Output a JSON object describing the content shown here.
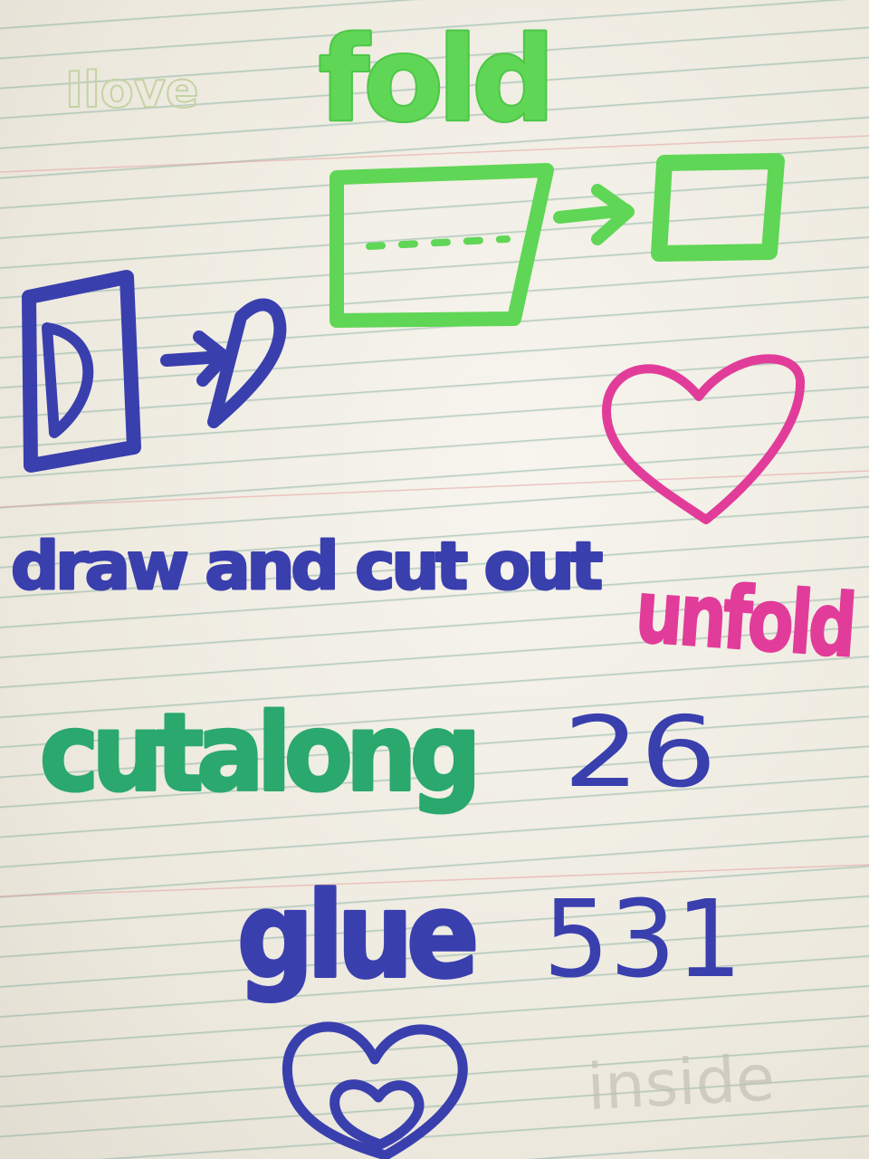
{
  "page": {
    "texts": {
      "faint_top": "Ilove",
      "fold": "fold",
      "draw_cut": "draw and cut out",
      "unfold": "unfold",
      "cut_along": "cutalong",
      "num_26": "26",
      "glue": "glue",
      "num_531": "531",
      "faint_bottom": "inside"
    },
    "colors": {
      "green": "#5fd655",
      "blue": "#3a3fae",
      "pink": "#e23c9a",
      "teal": "#2aa86e",
      "faint": "#b9c7a2",
      "ruled_line": "#8fb8a8",
      "margin_line": "#e6a0a0"
    },
    "icons": [
      "fold-diagram-icon",
      "cut-diagram-icon",
      "heart-icon",
      "double-heart-icon"
    ]
  }
}
